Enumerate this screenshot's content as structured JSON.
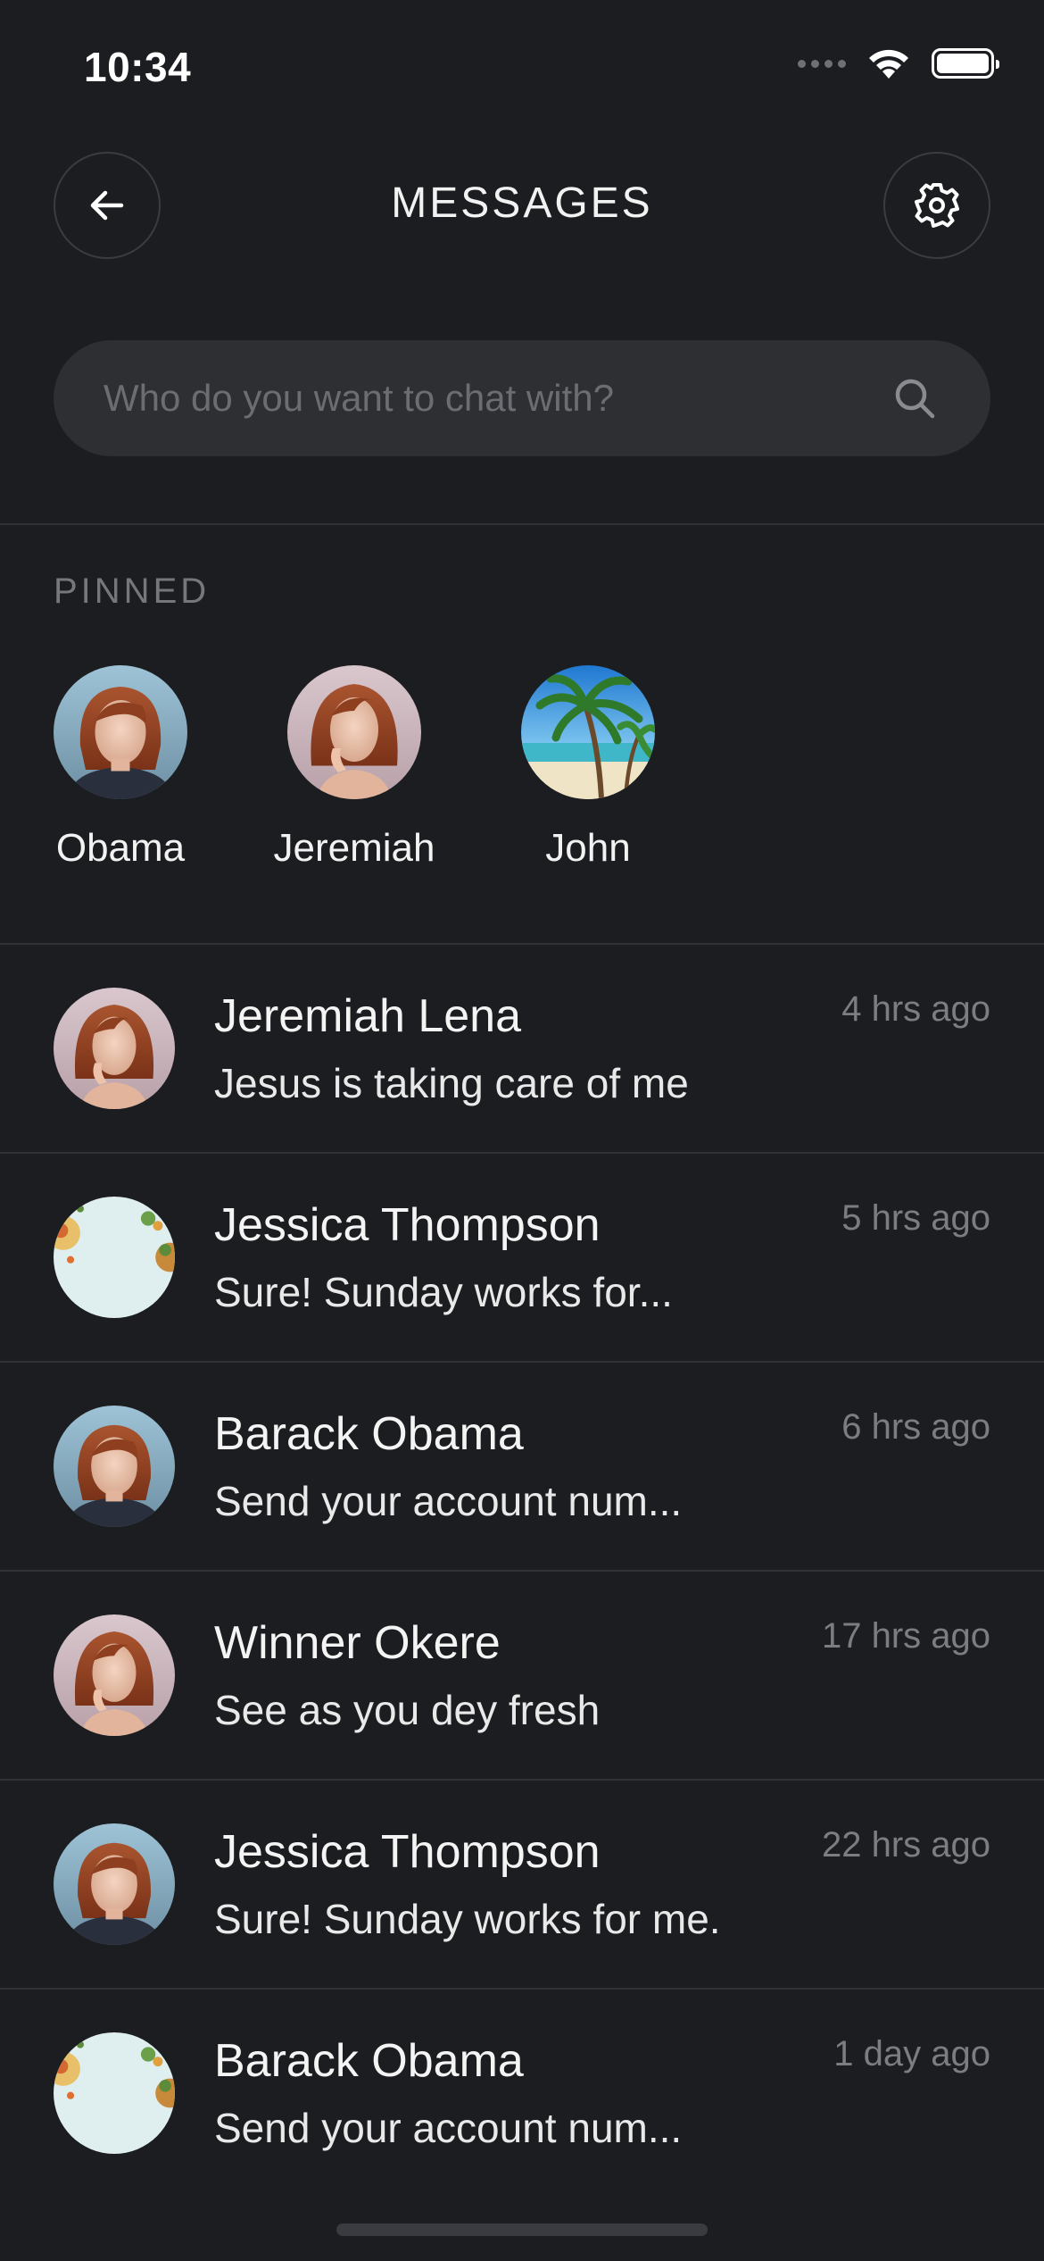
{
  "status_bar": {
    "time": "10:34"
  },
  "header": {
    "title": "MESSAGES",
    "back_icon": "arrow-left-icon",
    "settings_icon": "gear-icon"
  },
  "search": {
    "placeholder": "Who do you want to chat with?",
    "value": "",
    "icon": "search-icon"
  },
  "pinned": {
    "label": "PINNED",
    "items": [
      {
        "name": "Obama",
        "avatar": "portrait-woman-blue-avatar"
      },
      {
        "name": "Jeremiah",
        "avatar": "portrait-woman-pink-avatar"
      },
      {
        "name": "John",
        "avatar": "palm-beach-avatar"
      }
    ]
  },
  "chats": [
    {
      "name": "Jeremiah Lena",
      "message": "Jesus is taking care of me",
      "time": "4 hrs ago",
      "avatar": "portrait-woman-pink-avatar"
    },
    {
      "name": "Jessica Thompson",
      "message": "Sure! Sunday works for...",
      "time": "5 hrs ago",
      "avatar": "food-plate-avatar"
    },
    {
      "name": "Barack Obama",
      "message": "Send your account num...",
      "time": "6 hrs ago",
      "avatar": "portrait-woman-blue-avatar"
    },
    {
      "name": "Winner Okere",
      "message": "See as you dey fresh",
      "time": "17 hrs ago",
      "avatar": "portrait-woman-pink-avatar"
    },
    {
      "name": "Jessica Thompson",
      "message": "Sure! Sunday works for me.",
      "time": "22 hrs ago",
      "avatar": "portrait-woman-blue-avatar"
    },
    {
      "name": "Barack Obama",
      "message": "Send your account num...",
      "time": "1 day ago",
      "avatar": "food-plate-avatar"
    }
  ],
  "colors": {
    "background": "#1c1d20",
    "search_bg": "#2e2f33",
    "muted_text": "#7c7d82",
    "divider": "#303135"
  }
}
